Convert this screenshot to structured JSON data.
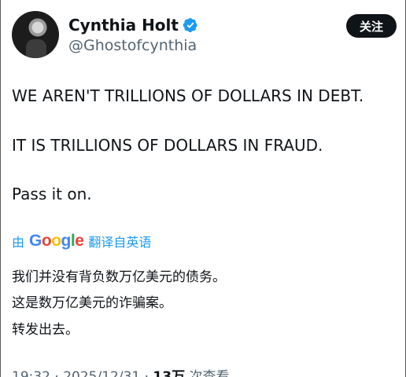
{
  "author": {
    "display_name": "Cynthia Holt",
    "handle": "@Ghostofcynthia",
    "verified": true
  },
  "follow_button": {
    "label": "关注"
  },
  "tweet": {
    "lines": [
      "WE AREN'T TRILLIONS OF DOLLARS IN DEBT.",
      "IT IS TRILLIONS OF DOLLARS IN FRAUD.",
      "Pass it on."
    ]
  },
  "translation": {
    "prefix": "由",
    "provider": "Google",
    "suffix": "翻译自英语",
    "lines": [
      "我们并没有背负数万亿美元的债务。",
      "这是数万亿美元的诈骗案。",
      "转发出去。"
    ]
  },
  "meta": {
    "time": "19:32",
    "separator_1": "·",
    "date": "2025/12/31",
    "separator_2": "·",
    "views_count": "13万",
    "views_label": "次查看"
  },
  "colors": {
    "verified": "#1d9bf0",
    "link": "#1d9bf0",
    "secondary_text": "#536471",
    "primary_text": "#0f1419",
    "follow_bg": "#0f1419"
  },
  "icons": {
    "verified": "verified-badge-icon"
  }
}
